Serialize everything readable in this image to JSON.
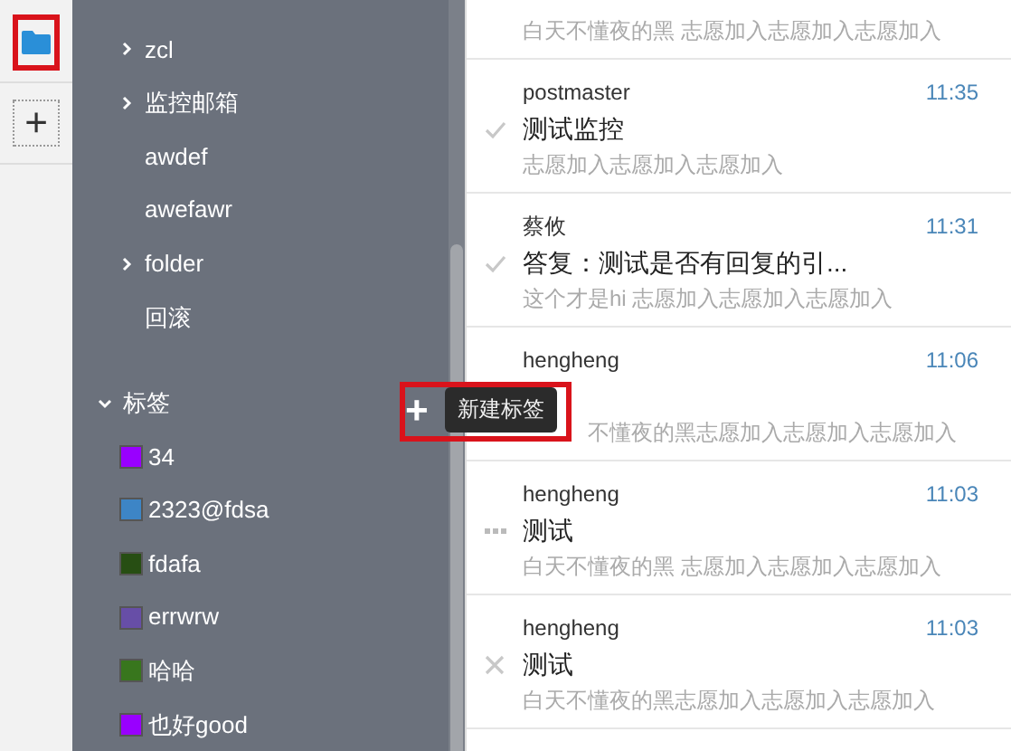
{
  "rail": {
    "add_label": "+"
  },
  "folders": {
    "items": [
      {
        "label": "zcl",
        "has_children": true
      },
      {
        "label": "监控邮箱",
        "has_children": true
      },
      {
        "label": "awdef",
        "has_children": false
      },
      {
        "label": "awefawr",
        "has_children": false
      },
      {
        "label": "folder",
        "has_children": true
      },
      {
        "label": "回滚",
        "has_children": false
      }
    ]
  },
  "tags": {
    "title": "标签",
    "expanded": true,
    "add_label": "+",
    "tooltip": "新建标签",
    "items": [
      {
        "label": "34",
        "color": "#9900ff"
      },
      {
        "label": "2323@fdsa",
        "color": "#3d85c6"
      },
      {
        "label": "fdafa",
        "color": "#274e13"
      },
      {
        "label": "errwrw",
        "color": "#674ea7"
      },
      {
        "label": "哈哈",
        "color": "#38761d"
      },
      {
        "label": "也好good",
        "color": "#9900ff"
      }
    ]
  },
  "messages": [
    {
      "preview": "白天不懂夜的黑 志愿加入志愿加入志愿加入"
    },
    {
      "sender": "postmaster",
      "subject": "测试监控",
      "preview": "志愿加入志愿加入志愿加入",
      "time": "11:35",
      "kind": "check"
    },
    {
      "sender": "蔡攸",
      "subject": "答复：测试是否有回复的引...",
      "preview": "这个才是hi 志愿加入志愿加入志愿加入",
      "time": "11:31",
      "kind": "check"
    },
    {
      "sender": "hengheng",
      "preview": "不懂夜的黑志愿加入志愿加入志愿加入",
      "time": "11:06",
      "covered": true
    },
    {
      "sender": "hengheng",
      "subject": "测试",
      "preview": "白天不懂夜的黑 志愿加入志愿加入志愿加入",
      "time": "11:03",
      "kind": "dots"
    },
    {
      "sender": "hengheng",
      "subject": "测试",
      "preview": "白天不懂夜的黑志愿加入志愿加入志愿加入",
      "time": "11:03",
      "kind": "cross"
    }
  ]
}
